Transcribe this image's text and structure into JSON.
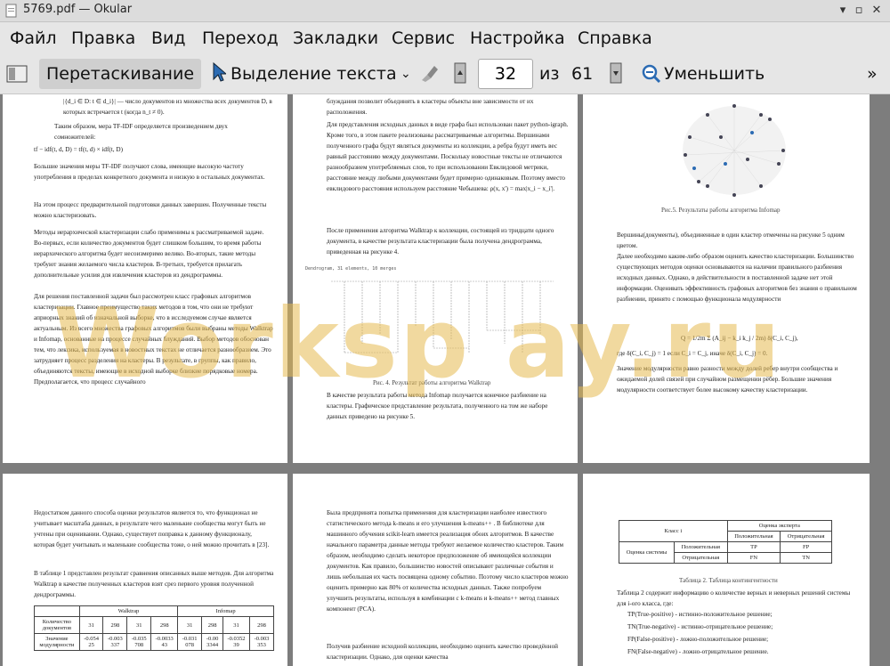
{
  "window": {
    "title": "5769.pdf  — Okular"
  },
  "menu": [
    "Файл",
    "Правка",
    "Вид",
    "Переход",
    "Закладки",
    "Сервис",
    "Настройка",
    "Справка"
  ],
  "toolbar": {
    "drag_label": "Перетаскивание",
    "select_label": "Выделение текста",
    "page_value": "32",
    "of_label": "из",
    "total_pages": "61",
    "zoom_out_label": "Уменьшить"
  },
  "watermark": "Worksp ay.ru",
  "pages": {
    "p1": {
      "formula": "|{d_i ∈ D: t ∈ d_i}| — число документов из множества всех документов D, в которых встречается t (когда n_t ≠ 0).",
      "l1": "Таким образом, мера TF-IDF определяется произведением двух сомножителей:",
      "l2": "tf − idf(t, d, D) = tf(t, d) × idf(t, D)",
      "l3": "Большие значения меры TF-IDF получают слова, имеющие высокую частоту употребления в пределах конкретного документа и низкую в остальных документах.",
      "l4": "На этом процесс предварительной подготовки данных завершен. Полученные тексты можно кластеризовать.",
      "l5": "Методы иерархической кластеризации слабо применимы к рассматриваемой задаче. Во-первых, если количество документов будет слишком большим, то время работы иерархического алгоритма будет несоизмеримо велико. Во-вторых, такие методы требуют знания желаемого числа кластеров. В-третьих, требуется прилагать дополнительные усилия для извлечения кластеров из дендрограммы.",
      "l6": "Для решения поставленной задачи был рассмотрен класс графовых алгоритмов кластеризации. Главное преимущество таких методов в том, что они не требуют априорных знаний об изначальной выборке, что в исследуемом случае является актуальным. Из всего множества графовых алгоритмов были выбраны методы Walktrap и Infomap, основанные на процессе случайных блужданий. Выбор методов обоснован тем, что лексика, используемая в новостных текстах не отличается разнообразием. Это затрудняет процесс разделения на кластеры. В результате, в группы, как правило, объединяются тексты, имеющие в исходной выборке близкие порядковые номера. Предполагается, что процесс случайного"
    },
    "p2": {
      "l1": "блуждания позволит объединять в кластеры объекты вне зависимости от их расположения.",
      "l2": "Для представления исходных данных в виде графа был использован пакет python-igraph. Кроме того, в этом пакете реализованы рассматриваемые алгоритмы. Вершинами полученного графа будут являться документы из коллекции, а ребра будут иметь вес равный расстоянию между документами. Поскольку новостные тексты не отличаются разнообразием употребляемых слов, то при использовании Евклидовой метрики, расстояние между любыми документами будет примерно одинаковым. Поэтому вместо евклидового расстояния используем расстояние Чебышева: ρ(x, x') = max|x_i − x_i'|.",
      "l3": "После применения алгоритма Walktrap к коллекции, состоящей из тридцати одного документа, в качестве результата кластеризации была получена дендрограмма, приведенная на рисунке 4.",
      "dendro_title": "Dendrogram, 31 elements, 10 merges",
      "caption": "Рис. 4. Результат работы алгоритма Walktrap",
      "l4": "В качестве результата работы метода Infomap получается конечное разбиение на кластеры. Графическое представление результата, полученного на том же наборе данных приведено на рисунке 5."
    },
    "p3": {
      "caption": "Рис.5. Результаты работы алгоритма Infomap",
      "l1": "Вершины(документы), объединенные в один кластер отмечены на рисунке 5 одним цветом.",
      "l2": "Далее необходимо каким-либо образом оценить качество кластеризации. Большинство существующих методов оценки основываются на наличии правильного разбиения исходных данных. Однако, в действительности в поставленной задаче нет этой информации. Оценивать эффективность графовых алгоритмов без знания о правильном разбиении, принято с помощью функционала модулярности",
      "formula": "Q = 1/2m Σ (A_ij − k_i k_j / 2m) δ(C_i, C_j),",
      "l3": "где δ(C_i, C_j) = 1 если C_i = C_j, иначе δ(C_i, C_j) = 0.",
      "l4": "Значение модулярности равно разности между долей ребер внутри сообщества и ожидаемой долей связей при случайном размещении рёбер. Большие значения модулярности соответствует более высокому качеству кластеризации."
    },
    "p4": {
      "l1": "Недостатком данного способа оценки результатов является то, что функционал не учитывает масштаба данных, в результате чего маленькие сообщества могут быть не учтены при оценивании. Однако, существует поправка к данному функционалу, которая будет учитывать и маленькие сообщества тоже, о ней можно прочитать в [23].",
      "l2": "В таблице 1 представлен результат сравнения описанных выше методов. Для алгоритма Walktrap в качестве полученных кластеров взят срез первого уровня полученной дендрограммы.",
      "th_walktrap": "Walktrap",
      "th_infomap": "Infomap",
      "row1_label": "Количество документов",
      "row1": [
        "31",
        "298",
        "31",
        "298",
        "31",
        "298",
        "31",
        "298"
      ],
      "row2_label": "Значение модулярности",
      "row2": [
        "-0.054 25",
        "-0.003 337",
        "-0.035 708",
        "-0.0033 43",
        "-0.031 078",
        "-0.00 3344",
        "-0.0352 39",
        "-0.003 353"
      ]
    },
    "p5": {
      "l1": "Была предпринята попытка применения для кластеризации наиболее известного статистического метода k-means и его улучшения k-means++ . В библиотеке для машинного обучения scikit-learn имеется реализация обоих алгоритмов. В качестве начального параметра данные методы требуют желаемое количество кластеров. Таким образом, необходимо сделать некоторое предположение об имеющейся коллекции документов. Как правило, большинство новостей описывают различные события и лишь небольшая их часть посвящена одному событию. Поэтому число кластеров можно оценить примерно как 80% от количества исходных данных. Также попробуем улучшить результаты, используя в комбинации с k-means и k-means++ метод главных компонент (PCA).",
      "l2": "Получив разбиение исходной коллекции, необходимо оценить качество проведённой кластеризации. Однако, для оценки качества"
    },
    "p6": {
      "class_i": "Класс i",
      "expert": "Оценка эксперта",
      "positive": "Положительная",
      "negative": "Отрицательная",
      "system": "Оценка системы",
      "tp": "TP",
      "fp": "FP",
      "fn": "FN",
      "tn": "TN",
      "caption": "Таблица 2. Таблица контингентности",
      "l1": "Таблица 2 содержит информацию о количестве верных и неверных решений системы для i-ого класса, где:",
      "b1": "TP(True-positive) - истинно-положительное решение;",
      "b2": "TN(True-negative) - истинно-отрицательное решение;",
      "b3": "FP(False-positive) - ложно-положительное решение;",
      "b4": "FN(False-negative) - ложно-отрицательное решение."
    }
  },
  "colors": {
    "accent": "#2b6bb3",
    "watermark": "#e6b950",
    "background": "#7d7d7d"
  }
}
